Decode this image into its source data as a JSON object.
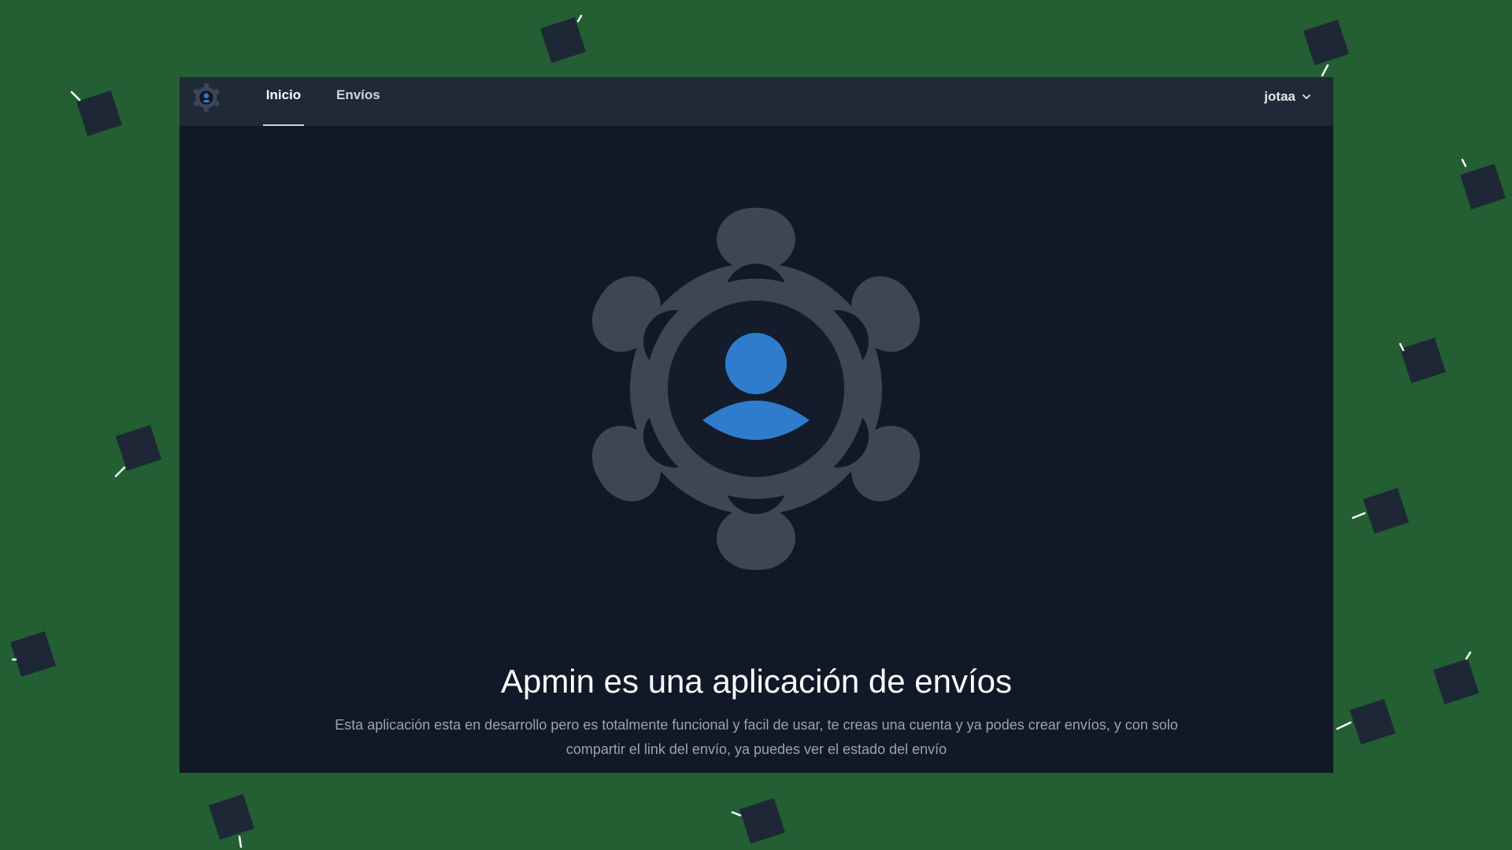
{
  "colors": {
    "background": "#235f33",
    "window": "#111827",
    "navbar": "#1f2937",
    "gear": "#3d4654",
    "accent_blue": "#2f7ccc",
    "decor_square": "#1e2735"
  },
  "navbar": {
    "logo_icon": "gear-user-icon",
    "links": [
      {
        "label": "Inicio",
        "active": true
      },
      {
        "label": "Envíos",
        "active": false
      }
    ],
    "user": {
      "name": "jotaa",
      "dropdown_icon": "chevron-down-icon"
    }
  },
  "hero": {
    "icon": "gear-user-icon",
    "title": "Apmin es una aplicación de envíos",
    "description": "Esta aplicación esta en desarrollo pero es totalmente funcional y facil de usar, te creas una cuenta y ya podes crear envíos, y con solo compartir el link del envío, ya puedes ver el estado del envío"
  }
}
